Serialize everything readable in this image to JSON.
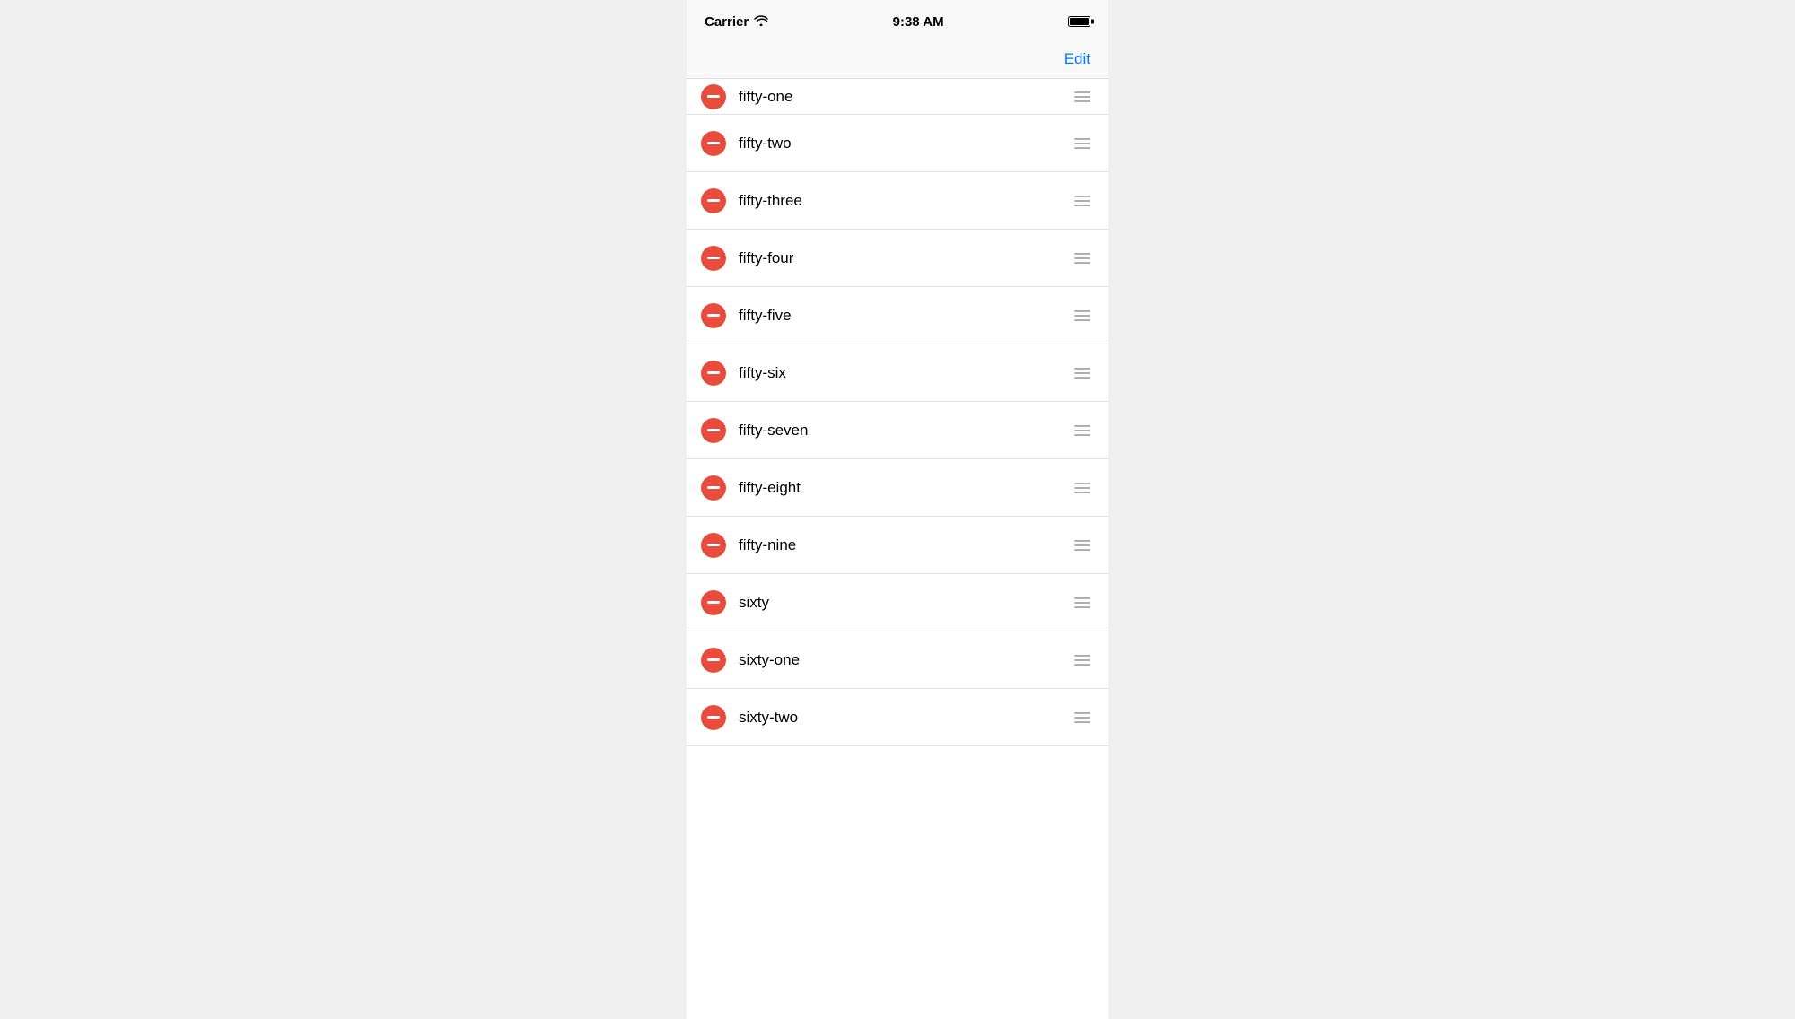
{
  "statusBar": {
    "carrier": "Carrier",
    "time": "9:38 AM"
  },
  "navBar": {
    "editLabel": "Edit"
  },
  "listItems": [
    {
      "id": "fifty-one",
      "label": "fifty-one",
      "partial": true
    },
    {
      "id": "fifty-two",
      "label": "fifty-two",
      "partial": false
    },
    {
      "id": "fifty-three",
      "label": "fifty-three",
      "partial": false
    },
    {
      "id": "fifty-four",
      "label": "fifty-four",
      "partial": false
    },
    {
      "id": "fifty-five",
      "label": "fifty-five",
      "partial": false
    },
    {
      "id": "fifty-six",
      "label": "fifty-six",
      "partial": false
    },
    {
      "id": "fifty-seven",
      "label": "fifty-seven",
      "partial": false
    },
    {
      "id": "fifty-eight",
      "label": "fifty-eight",
      "partial": false
    },
    {
      "id": "fifty-nine",
      "label": "fifty-nine",
      "partial": false
    },
    {
      "id": "sixty",
      "label": "sixty",
      "partial": false
    },
    {
      "id": "sixty-one",
      "label": "sixty-one",
      "partial": false
    },
    {
      "id": "sixty-two",
      "label": "sixty-two",
      "partial": false
    }
  ]
}
